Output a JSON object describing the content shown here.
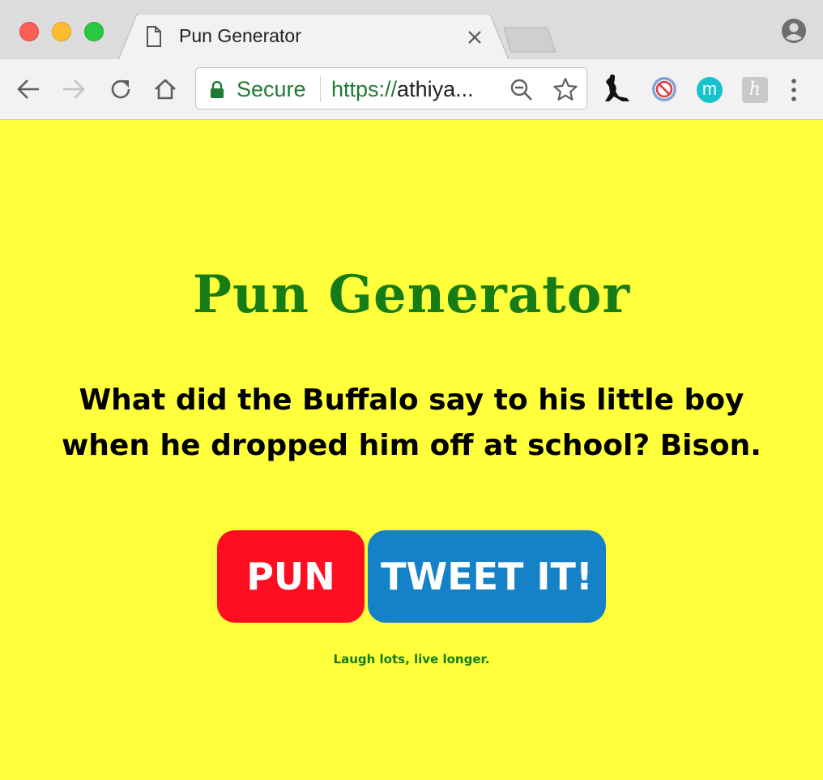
{
  "browser": {
    "tab": {
      "title": "Pun Generator"
    },
    "omnibox": {
      "secure_label": "Secure",
      "url_scheme": "https://",
      "url_host": "athiya..."
    },
    "extensions": {
      "m_label": "m",
      "h_label": "h"
    }
  },
  "page": {
    "title": "Pun Generator",
    "pun": "What did the Buffalo say to his little boy when he dropped him off at school? Bison.",
    "pun_button": "PUN",
    "tweet_button": "TWEET IT!",
    "tagline": "Laugh lots, live longer."
  },
  "colors": {
    "background": "#ffff3c",
    "title": "#167d16",
    "pun_button": "#ff0d20",
    "tweet_button": "#1582c8",
    "secure_green": "#1e7b34"
  },
  "icons": [
    "page-icon",
    "close-icon",
    "profile-icon",
    "back-arrow-icon",
    "forward-arrow-icon",
    "reload-icon",
    "home-icon",
    "lock-icon",
    "zoom-out-icon",
    "star-icon",
    "climber-extension-icon",
    "block-extension-icon",
    "m-extension-icon",
    "h-extension-icon",
    "menu-dots-icon"
  ]
}
